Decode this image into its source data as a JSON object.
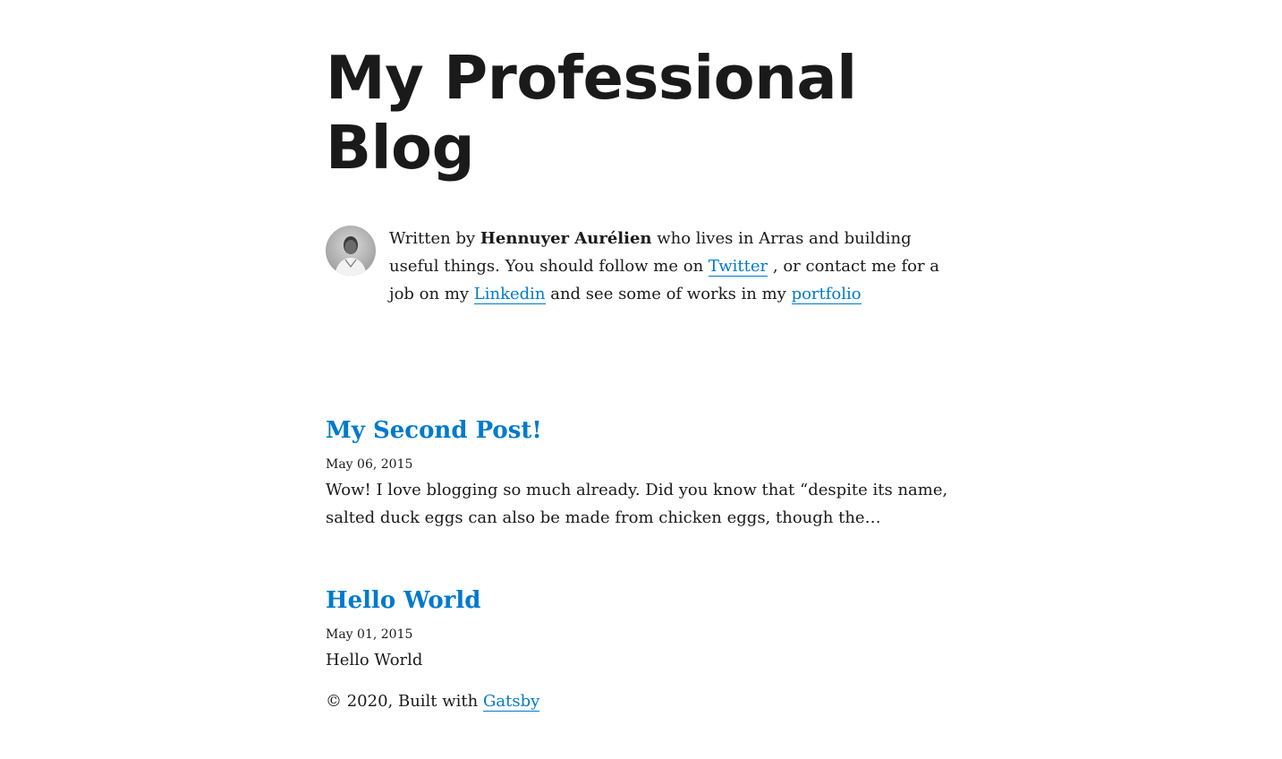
{
  "site": {
    "title_line1": "My Professional",
    "title_line2": "Blog"
  },
  "bio": {
    "avatar_icon": "author-avatar",
    "prefix": "Written by ",
    "author": "Hennuyer Aurélien",
    "text1": " who lives in Arras and building useful things. You should follow me on ",
    "twitter_label": "Twitter",
    "text2": " , or contact me for a job on my ",
    "linkedin_label": "Linkedin",
    "text3": " and see some of works in my ",
    "portfolio_label": "portfolio"
  },
  "posts": [
    {
      "title": "My Second Post!",
      "date": "May 06, 2015",
      "excerpt": "Wow! I love blogging so much already. Did you know that “despite its name, salted duck eggs can also be made from chicken eggs, though the…"
    },
    {
      "title": "Hello World",
      "date": "May 01, 2015",
      "excerpt": "Hello World"
    }
  ],
  "footer": {
    "text": "© 2020, Built with ",
    "gatsby_label": "Gatsby"
  },
  "colors": {
    "link": "#007acc",
    "text": "#1a1a1a",
    "background": "#ffffff"
  }
}
